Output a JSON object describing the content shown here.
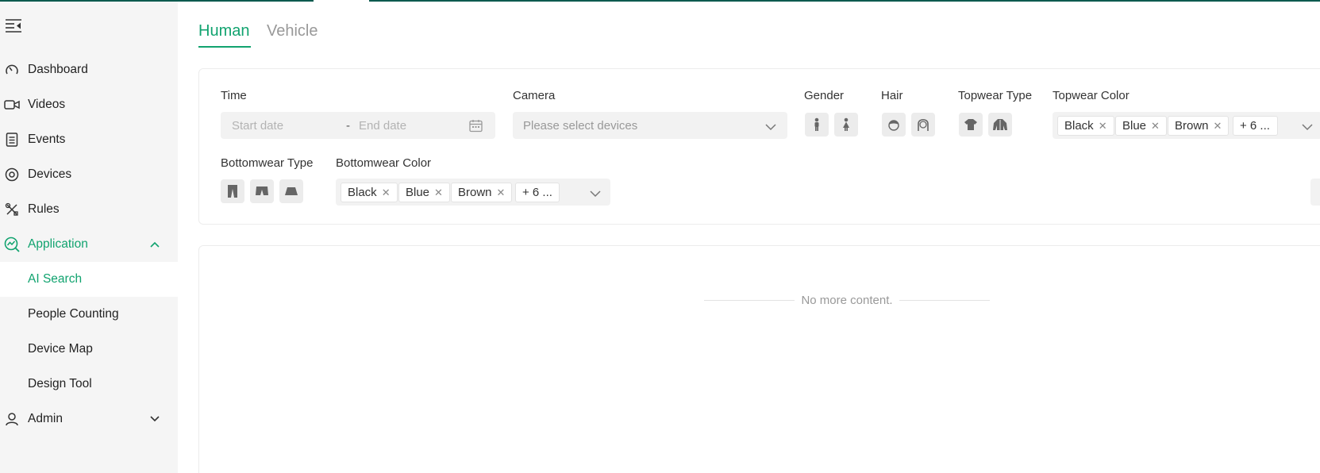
{
  "sidebar": {
    "items": [
      {
        "label": "Dashboard",
        "icon": "gauge-icon"
      },
      {
        "label": "Videos",
        "icon": "video-camera-icon"
      },
      {
        "label": "Events",
        "icon": "document-list-icon"
      },
      {
        "label": "Devices",
        "icon": "device-circle-icon"
      },
      {
        "label": "Rules",
        "icon": "tools-icon"
      },
      {
        "label": "Application",
        "icon": "analytics-search-icon",
        "expanded": true
      },
      {
        "label": "AI Search",
        "selected": true
      },
      {
        "label": "People Counting"
      },
      {
        "label": "Device Map"
      },
      {
        "label": "Design Tool"
      },
      {
        "label": "Admin",
        "icon": "user-icon",
        "expanded": false
      }
    ]
  },
  "tabs": [
    {
      "label": "Human",
      "active": true
    },
    {
      "label": "Vehicle",
      "active": false
    }
  ],
  "filters": {
    "time": {
      "label": "Time",
      "start_placeholder": "Start date",
      "separator": "-",
      "end_placeholder": "End date"
    },
    "camera": {
      "label": "Camera",
      "placeholder": "Please select devices"
    },
    "gender": {
      "label": "Gender",
      "options": [
        "male-icon",
        "female-icon"
      ]
    },
    "hair": {
      "label": "Hair",
      "options": [
        "short-hair-icon",
        "long-hair-icon"
      ]
    },
    "topwear_type": {
      "label": "Topwear Type",
      "options": [
        "short-sleeve-icon",
        "long-sleeve-icon"
      ]
    },
    "topwear_color": {
      "label": "Topwear Color",
      "tags": [
        "Black",
        "Blue",
        "Brown"
      ],
      "more": "+ 6 ..."
    },
    "bottomwear_type": {
      "label": "Bottomwear Type",
      "options": [
        "trousers-icon",
        "shorts-icon",
        "skirt-icon"
      ]
    },
    "bottomwear_color": {
      "label": "Bottomwear Color",
      "tags": [
        "Black",
        "Blue",
        "Brown"
      ],
      "more": "+ 6 ..."
    }
  },
  "results": {
    "empty_text": "No more content."
  },
  "colors": {
    "accent": "#11a36f",
    "sidebar_bg": "#f5f5f5",
    "top_border": "#0a5a4e",
    "field_bg": "#f2f2f2"
  }
}
